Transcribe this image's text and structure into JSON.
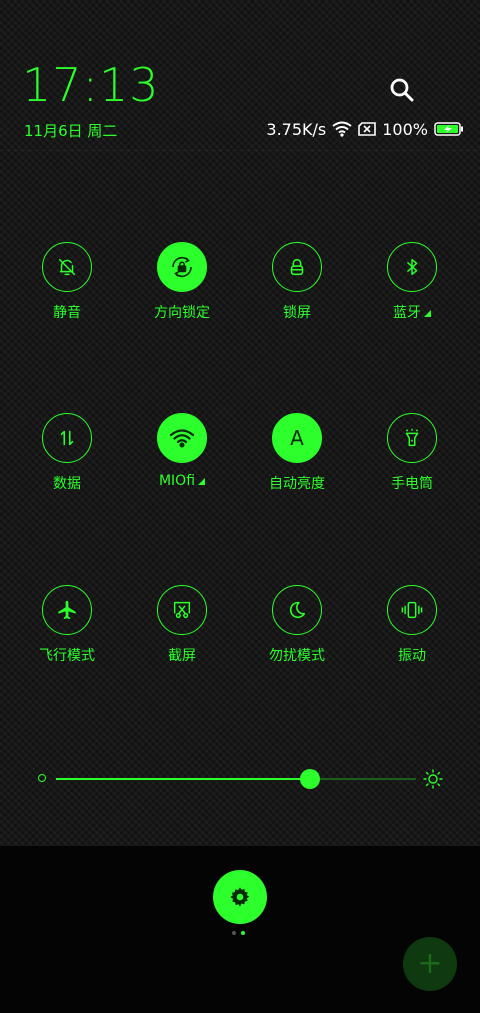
{
  "header": {
    "time": "17:13",
    "date": "11月6日 周二"
  },
  "status": {
    "speed": "3.75K/s",
    "battery": "100%"
  },
  "tiles": [
    {
      "label": "静音",
      "icon": "bell-off-icon",
      "active": false
    },
    {
      "label": "方向锁定",
      "icon": "rotation-lock-icon",
      "active": true
    },
    {
      "label": "锁屏",
      "icon": "lock-icon",
      "active": false
    },
    {
      "label": "蓝牙",
      "icon": "bluetooth-icon",
      "active": false,
      "expandable": true
    },
    {
      "label": "数据",
      "icon": "mobile-data-icon",
      "active": false
    },
    {
      "label": "MIOfi",
      "icon": "wifi-icon",
      "active": true,
      "expandable": true
    },
    {
      "label": "自动亮度",
      "icon": "auto-brightness-icon",
      "active": true
    },
    {
      "label": "手电筒",
      "icon": "flashlight-icon",
      "active": false
    },
    {
      "label": "飞行模式",
      "icon": "airplane-icon",
      "active": false
    },
    {
      "label": "截屏",
      "icon": "screenshot-icon",
      "active": false
    },
    {
      "label": "勿扰模式",
      "icon": "moon-icon",
      "active": false
    },
    {
      "label": "振动",
      "icon": "vibrate-icon",
      "active": false
    }
  ],
  "brightness": {
    "level": 0.705
  },
  "autoBrightnessLetter": "A",
  "colors": {
    "accent": "#2cff2c",
    "background": "#161716",
    "dock": "#040404"
  }
}
